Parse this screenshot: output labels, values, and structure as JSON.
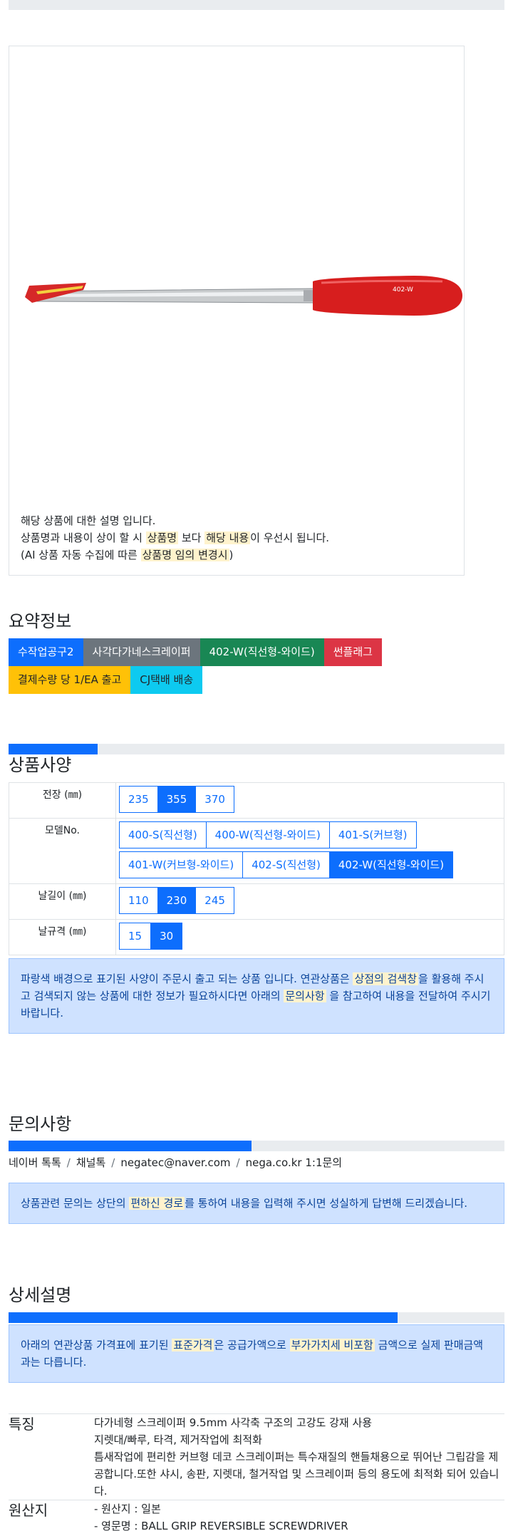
{
  "product": {
    "image_alt": "402-W 스크레이퍼",
    "handle_text": "402-W",
    "desc_line1": "해당 상품에 대한 설명 입니다.",
    "desc_line2_a": "상품명과 내용이 상이 할 시 ",
    "desc_line2_hl1": "상품명",
    "desc_line2_b": " 보다 ",
    "desc_line2_hl2": "해당 내용",
    "desc_line2_c": "이 우선시 됩니다.",
    "desc_line3_a": "(AI 상품 자동 수집에 따른 ",
    "desc_line3_hl": "상품명 임의 변경시",
    "desc_line3_b": ")"
  },
  "summary": {
    "title": "요약정보",
    "badges_row1": [
      {
        "label": "수작업공구2",
        "color": "#0d6efd"
      },
      {
        "label": "사각다가네스크레이퍼",
        "color": "#6c757d"
      },
      {
        "label": "402-W(직선형-와이드)",
        "color": "#198754"
      },
      {
        "label": "썬플래그",
        "color": "#dc3545"
      }
    ],
    "badges_row2": [
      {
        "label": "결제수량 당 1/EA 출고",
        "color": "#ffc107"
      },
      {
        "label": "CJ택배 배송",
        "color": "#0dcaf0"
      }
    ]
  },
  "specs": {
    "title": "상품사양",
    "progress_fraction": 0.18,
    "rows": [
      {
        "label": "전장 (㎜)",
        "options": [
          [
            "235",
            "355",
            "370"
          ]
        ],
        "selected": "355"
      },
      {
        "label": "모델No.",
        "options": [
          [
            "400-S(직선형)",
            "400-W(직선형-와이드)",
            "401-S(커브형)"
          ],
          [
            "401-W(커브형-와이드)",
            "402-S(직선형)",
            "402-W(직선형-와이드)"
          ]
        ],
        "selected": "402-W(직선형-와이드)"
      },
      {
        "label": "날길이 (㎜)",
        "options": [
          [
            "110",
            "230",
            "245"
          ]
        ],
        "selected": "230"
      },
      {
        "label": "날규격 (㎜)",
        "options": [
          [
            "15",
            "30"
          ]
        ],
        "selected": "30"
      }
    ],
    "notice_a": "파랑색 배경으로 표기된 사양이 주문시 출고 되는 상품 입니다. 연관상품은 ",
    "notice_hl1": "상점의 검색창",
    "notice_b": "을 활용해 주시고 검색되지 않는 상품에 대한 정보가 필요하시다면 아래의 ",
    "notice_hl2": "문의사항",
    "notice_c": " 을 참고하여 내용을 전달하여 주시기 바랍니다."
  },
  "inquiry": {
    "title": "문의사항",
    "progress_fraction": 0.49,
    "contacts": [
      "네이버 톡톡",
      "채널톡",
      "negatec@naver.com",
      "nega.co.kr 1:1문의"
    ],
    "separator": "/",
    "notice_a": "상품관련 문의는 상단의 ",
    "notice_hl": "편하신 경로",
    "notice_b": "를 통하여 내용을 입력해 주시면 성실하게 답변해 드리겠습니다."
  },
  "details": {
    "title": "상세설명",
    "progress_fraction": 0.785,
    "notice_a": "아래의 연관상품 가격표에 표기된 ",
    "notice_hl1": "표준가격",
    "notice_b": "은 공급가액으로 ",
    "notice_hl2": "부가가치세 비포함",
    "notice_c": " 금액으로 실제 판매금액과는 다릅니다.",
    "feature_key": "특징",
    "feature_lines": [
      "다가네형 스크레이퍼 9.5mm 사각축 구조의 고강도 강재 사용",
      "지렛대/빠루, 타격, 제거작업에 최적화",
      "틈새작업에 편리한 커브형 데코 스크레이퍼는 특수재질의 핸들채용으로 뛰어난 그립감을 제공합니다.또한 샤시, 송판, 지렛대, 철거작업 및 스크레이퍼 등의 용도에 최적화 되어 있습니다."
    ],
    "origin_key": "원산지",
    "origin_lines": [
      "- 원산지 : 일본",
      "- 영문명 : BALL GRIP REVERSIBLE SCREWDRIVER"
    ]
  }
}
